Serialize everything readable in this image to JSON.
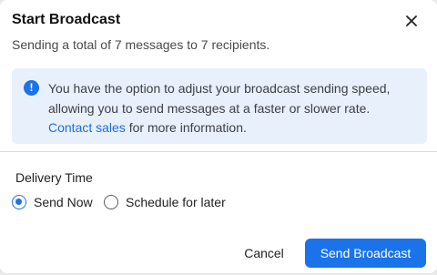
{
  "dialog": {
    "title": "Start Broadcast",
    "subtitle": "Sending a total of 7 messages to 7 recipients."
  },
  "info": {
    "icon": "info-icon",
    "icon_glyph": "!",
    "text_before_link": "You have the option to adjust your broadcast sending speed, allowing you to send messages at a faster or slower rate. ",
    "link_text": "Contact sales",
    "text_after_link": " for more information.",
    "accent_color": "#1a73e8",
    "background_color": "#e8f0fb"
  },
  "delivery": {
    "label": "Delivery Time",
    "options": [
      {
        "label": "Send Now",
        "selected": true
      },
      {
        "label": "Schedule for later",
        "selected": false
      }
    ]
  },
  "actions": {
    "cancel_label": "Cancel",
    "primary_label": "Send Broadcast",
    "primary_color": "#1a73e8"
  }
}
